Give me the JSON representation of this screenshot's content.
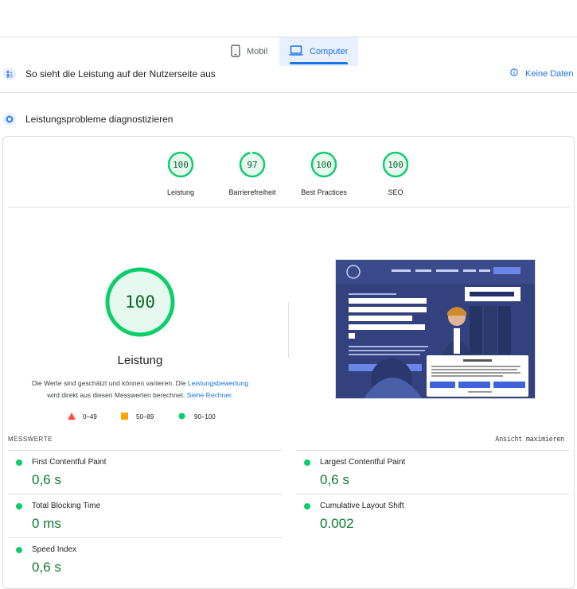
{
  "tabs": {
    "mobile": "Mobil",
    "desktop": "Computer"
  },
  "field_section": {
    "title": "So sieht die Leistung auf der Nutzerseite aus",
    "no_data": "Keine Daten"
  },
  "lab_section": {
    "title": "Leistungsprobleme diagnostizieren"
  },
  "scores": [
    {
      "value": "100",
      "label": "Leistung"
    },
    {
      "value": "97",
      "label": "Barrierefreiheit"
    },
    {
      "value": "100",
      "label": "Best Practices"
    },
    {
      "value": "100",
      "label": "SEO"
    }
  ],
  "score_fractions": [
    1.0,
    0.97,
    1.0,
    1.0
  ],
  "main_score": {
    "value": "100",
    "label": "Leistung"
  },
  "description": {
    "text1": "Die Werte sind geschätzt und können variieren. Die ",
    "link1": "Leistungsbewertung",
    "text2": "wird direkt aus diesen Messwerten berechnet. ",
    "link2": "Siehe Rechner."
  },
  "legend": {
    "poor": "0–49",
    "average": "50–89",
    "good": "90–100"
  },
  "metrics_header": {
    "title": "MESSWERTE",
    "expand": "Ansicht maximieren"
  },
  "metrics": [
    {
      "label": "First Contentful Paint",
      "value": "0,6 s"
    },
    {
      "label": "Largest Contentful Paint",
      "value": "0,6 s"
    },
    {
      "label": "Total Blocking Time",
      "value": "0 ms"
    },
    {
      "label": "Cumulative Layout Shift",
      "value": "0.002"
    },
    {
      "label": "Speed Index",
      "value": "0,6 s"
    }
  ],
  "colors": {
    "good": "#0cce6b",
    "average": "#ffa400",
    "poor": "#ff4e42",
    "accent": "#1a73e8"
  }
}
